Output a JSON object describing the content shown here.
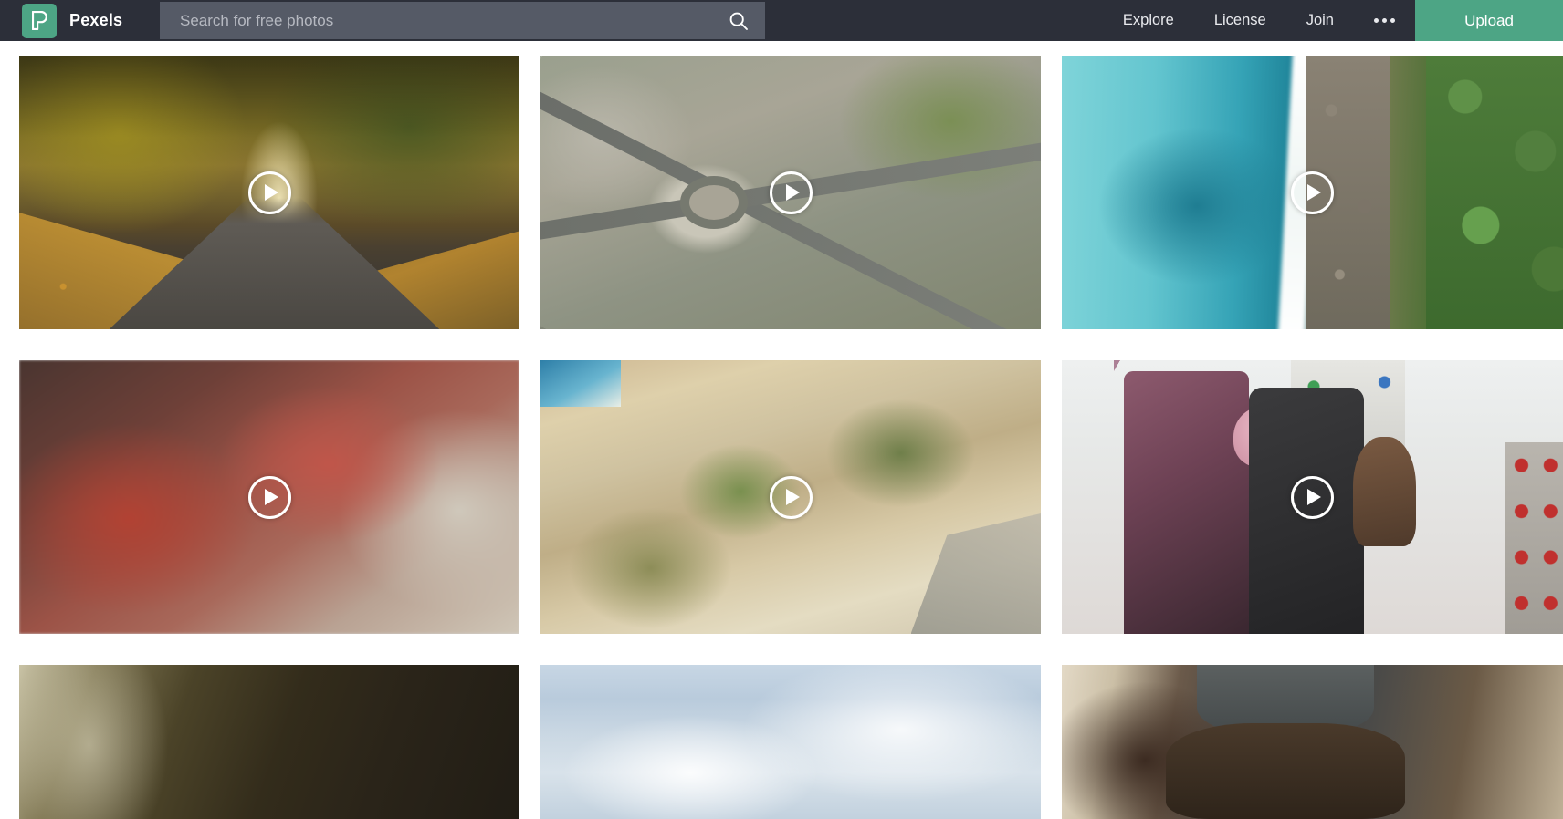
{
  "header": {
    "logo_text": "Pexels",
    "logo_icon": "pexels-p-logo-icon",
    "brand_color": "#4da585",
    "background_color": "#2c2f39",
    "search": {
      "placeholder": "Search for free photos",
      "value": "",
      "icon": "search-icon",
      "background_color": "#555a66"
    },
    "nav": [
      {
        "label": "Explore",
        "name": "explore"
      },
      {
        "label": "License",
        "name": "license"
      },
      {
        "label": "Join",
        "name": "join"
      }
    ],
    "more_menu": {
      "label": "•••",
      "icon": "ellipsis-icon"
    },
    "upload": {
      "label": "Upload",
      "color": "#4da585"
    }
  },
  "gallery": {
    "play_icon": "play-icon",
    "columns": 3,
    "items": [
      {
        "name": "autumn-forest-road",
        "alt": "Autumn forest road covered with fallen orange leaves",
        "thumb_class": "t-autumn-road",
        "row": 1,
        "col": 1
      },
      {
        "name": "aerial-city-roundabout",
        "alt": "Aerial view of a city roundabout with traffic",
        "thumb_class": "t-city-aerial",
        "row": 1,
        "col": 2
      },
      {
        "name": "aerial-turquoise-coastline",
        "alt": "Aerial view of turquoise sea meeting a forested rocky coastline",
        "thumb_class": "t-coast-aerial",
        "row": 1,
        "col": 3
      },
      {
        "name": "red-maple-leaves",
        "alt": "Close-up of red Japanese maple leaves",
        "thumb_class": "t-red-leaves",
        "row": 2,
        "col": 1
      },
      {
        "name": "aerial-coastal-dunes",
        "alt": "Aerial view of sandy coastal dunes and scrub",
        "thumb_class": "t-dunes-aerial",
        "row": 2,
        "col": 2
      },
      {
        "name": "amusement-park-ride",
        "alt": "Two women laughing on an amusement park ride",
        "thumb_class": "t-carnival",
        "row": 2,
        "col": 3
      },
      {
        "name": "dark-forest",
        "alt": "Dark forest trees backlit by pale light",
        "thumb_class": "t-dark-forest",
        "row": 3,
        "col": 1
      },
      {
        "name": "clouded-sky",
        "alt": "Pale blue sky filled with clouds",
        "thumb_class": "t-sky",
        "row": 3,
        "col": 2
      },
      {
        "name": "person-in-knit-hat",
        "alt": "Back of a person wearing a grey knit hat",
        "thumb_class": "t-portrait",
        "row": 3,
        "col": 3
      }
    ]
  }
}
